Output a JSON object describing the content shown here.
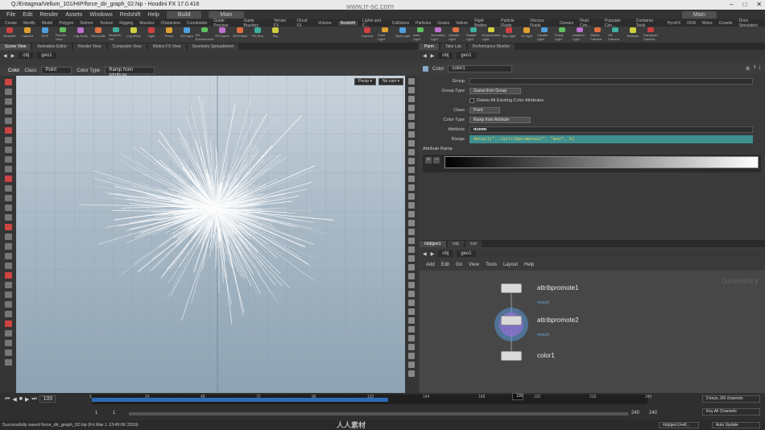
{
  "window": {
    "title": "Q:/Entagma/Vellum_101/HIP/force_dir_graph_02.hip - Houdini FX 17.0.416",
    "min": "–",
    "max": "□",
    "close": "✕"
  },
  "menu": {
    "items": [
      "File",
      "Edit",
      "Render",
      "Assets",
      "Windows",
      "Redshift",
      "Help"
    ],
    "build": "Build",
    "desktop": "Main",
    "desktop_right": "Main"
  },
  "shelf": {
    "tabs": [
      "Create",
      "Modify",
      "Model",
      "Polygon",
      "Deform",
      "Texture",
      "Rigging",
      "Muscles",
      "Characters",
      "Constraints",
      "Guide Process",
      "Guide Brushes",
      "Terrain FX",
      "Cloud FX",
      "Volume",
      "Redshift"
    ],
    "tools": [
      "Redshift",
      "Camera",
      "ROP",
      "Render View",
      "Log Tools",
      "Reconcile",
      "Redshift Vol",
      "Log Mesh",
      "Light",
      "Proxy",
      "RS Light",
      "RS Environment",
      "RS Dome",
      "RS Portal",
      "RS Sun",
      "Sky"
    ],
    "tabs_right": [
      "Lights and C...",
      "Collisions",
      "Particles",
      "Grains",
      "Vellum",
      "Rigid Bodies",
      "Particle Fluids",
      "Viscous Fluids",
      "Oceans",
      "Fluid Con...",
      "Populate Con...",
      "Container Tools",
      "PyroFX",
      "FEM",
      "Wires",
      "Crowds",
      "Drive Simulation"
    ],
    "tools_right": [
      "Camera",
      "Point Light",
      "Spot Light",
      "Area Light",
      "Geometry Light",
      "Volume Light",
      "Distant Light",
      "Environment Light",
      "Sky Light",
      "GI Light",
      "Caustic Light",
      "Portal Light",
      "Ambient Light",
      "Stereo Camera",
      "VR Camera",
      "Switcher",
      "Gamepad Camera"
    ]
  },
  "left_panel": {
    "tabs": [
      "Scene View",
      "Animation Editor",
      "Render View",
      "Composite View",
      "Motion FX View",
      "Geometry Spreadsheet"
    ],
    "path": [
      "obj",
      "geo1"
    ],
    "options": {
      "color_label": "Color",
      "class_label": "Class",
      "class_value": "Point",
      "colortype_label": "Color Type",
      "colortype_value": "Ramp from Attribute"
    },
    "persp": "Persp ▾",
    "cam": "No cam ▾"
  },
  "param_panel": {
    "tabs": [
      "Parm",
      "Take List",
      "Performance Monitor"
    ],
    "path": [
      "obj",
      "geo1"
    ],
    "node_type": "Color",
    "node_name": "color1",
    "rows": [
      {
        "label": "Group",
        "value": ""
      },
      {
        "label": "Group Type",
        "value": "Guess from Group"
      },
      {
        "label": "",
        "value": "Delete All Existing Color Attributes"
      },
      {
        "label": "Class",
        "value": "Point"
      },
      {
        "label": "Color Type",
        "value": "Ramp from Attribute"
      },
      {
        "label": "Attribute",
        "value": "ncenn"
      },
      {
        "label": "Range",
        "value": "detail(\"../attribpromote2/\", \"max\", 0)"
      }
    ],
    "ramp_label": "Attribute Ramp"
  },
  "net_panel": {
    "tabs": [
      "/obj/geo1",
      "/obj",
      "/out"
    ],
    "path": [
      "obj",
      "geo1"
    ],
    "menu": [
      "Add",
      "Edit",
      "Go",
      "View",
      "Tools",
      "Layout",
      "Help"
    ],
    "watermark": "Geometry",
    "nodes": [
      {
        "name": "attribpromote1",
        "sub": "ncount"
      },
      {
        "name": "attribpromote2",
        "sub": "ncount"
      },
      {
        "name": "color1",
        "sub": ""
      }
    ]
  },
  "timeline": {
    "frame": "100",
    "start": "1",
    "start2": "1",
    "end": "240",
    "end2": "240",
    "ticks": [
      "1",
      "24",
      "48",
      "72",
      "96",
      "120",
      "144",
      "168",
      "192",
      "216",
      "240"
    ],
    "playhead": 0.41,
    "keys_label": "0 keys, 0/0 channels",
    "key_all": "Key All Channels",
    "auto_update": "Auto Update",
    "path": "/obj/geo1/vell..."
  },
  "status": "Successfully saved force_dir_graph_02.hip (Fri Mar 1 13:49:06 2019)",
  "watermark_bottom": "人人素材",
  "watermark_top": "www.rr-sc.com",
  "colors": {
    "accent": "#4a90d9",
    "range_field": "#3f8f8f",
    "active_tab": "#505050"
  }
}
